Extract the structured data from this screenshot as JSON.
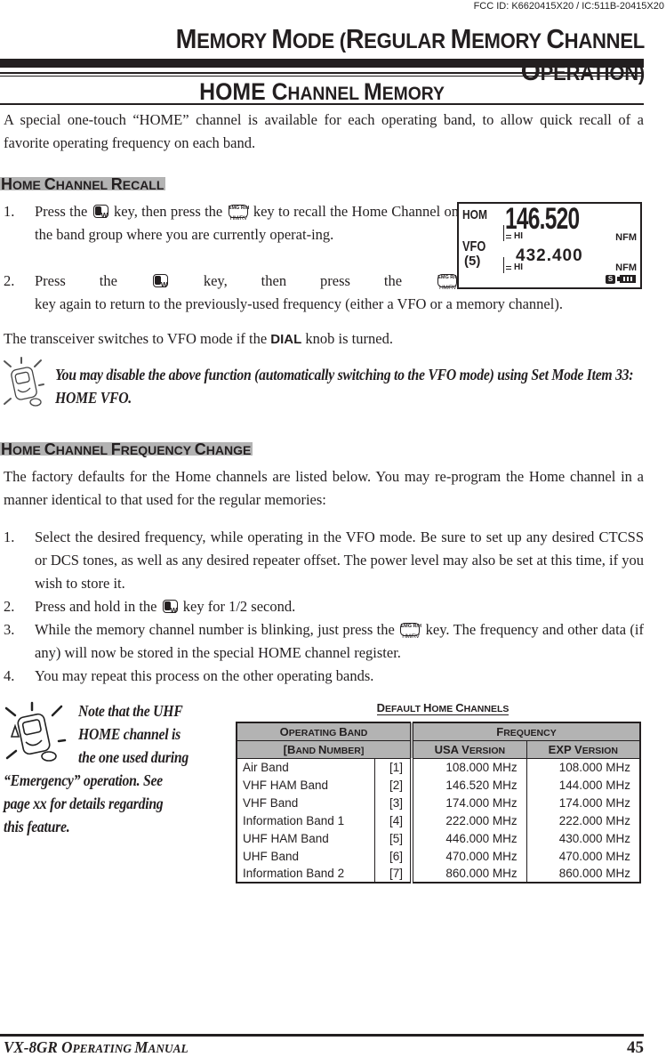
{
  "header": {
    "fcc_id": "FCC ID: K6620415X20 / IC:511B-20415X20",
    "chapter_title_cap1": "M",
    "chapter_title_rest1": "EMORY ",
    "chapter_title_cap2": "M",
    "chapter_title_rest2": "ODE (",
    "chapter_title_cap3": "R",
    "chapter_title_rest3": "EGULAR ",
    "chapter_title_cap4": "M",
    "chapter_title_rest4": "EMORY ",
    "chapter_title_cap5": "C",
    "chapter_title_rest5": "HANNEL ",
    "chapter_title_cap6": "O",
    "chapter_title_rest6": "PERATION)",
    "section_title_a": "HOME ",
    "section_title_cap2": "C",
    "section_title_rest2": "HANNEL ",
    "section_title_cap3": "M",
    "section_title_rest3": "EMORY"
  },
  "intro": "A special one-touch “HOME” channel is available for each operating band, to allow quick recall of a favorite operating frequency on each band.",
  "recall": {
    "heading_cap1": "H",
    "heading_rest1": "OME ",
    "heading_cap2": "C",
    "heading_rest2": "HANNEL ",
    "heading_cap3": "R",
    "heading_rest3": "ECALL",
    "steps": [
      {
        "num": "1.",
        "pre": "Press the",
        "mid": "key, then press the",
        "post": "key to recall the Home Channel on the band group where you are currently operat-ing."
      },
      {
        "num": "2.",
        "pre": "Press the",
        "mid": "key, then press the",
        "post": "key again to return to the previously-used frequency (either a VFO or a memory channel)."
      }
    ],
    "key_fw_label": "W",
    "key_hm_top": "EMG R/H",
    "key_hm_label": "HM/RV",
    "after_pre": "The transceiver switches to VFO mode if the ",
    "after_bold": "DIAL",
    "after_post": " knob is turned.",
    "tip": "You may disable the above function (automatically switching to the VFO mode) using Set Mode Item 33: HOME VFO."
  },
  "lcd": {
    "mode_top": "HOM",
    "freq_top": "146.520",
    "power_top": "HI",
    "mod_top": "NFM",
    "mode_bottom": "VFO",
    "channel_bottom": "(5)",
    "freq_bottom": "432.400",
    "power_bottom": "HI",
    "mod_bottom": "NFM",
    "squelch_icon": "S"
  },
  "change": {
    "heading_cap1": "H",
    "heading_rest1": "OME ",
    "heading_cap2": "C",
    "heading_rest2": "HANNEL ",
    "heading_cap3": "F",
    "heading_rest3": "REQUENCY ",
    "heading_cap4": "C",
    "heading_rest4": "HANGE",
    "intro": "The factory defaults for the Home channels are listed below. You may re-program the Home channel in a manner identical to that used for the regular memories:",
    "step1_num": "1.",
    "step1": "Select the desired frequency, while operating in the VFO mode. Be sure to set up any desired CTCSS or DCS tones, as well as any desired repeater offset. The power level may also be set at this time, if you wish to store it.",
    "step2_num": "2.",
    "step2_pre": "Press and hold in the",
    "step2_post": "key for 1/2 second.",
    "step3_num": "3.",
    "step3_pre": "While the memory channel number is blinking, just press the",
    "step3_post": "key. The frequency and other data (if any) will now be stored in the special HOME channel register.",
    "step4_num": "4.",
    "step4": "You may repeat this process on the other operating bands."
  },
  "note": {
    "line1": "Note that the UHF",
    "line2": "HOME channel is",
    "line3": "the one used during",
    "line4": "“Emergency” operation. See",
    "line5": "page xx for details regarding",
    "line6": "this feature."
  },
  "table": {
    "title_cap1": "D",
    "title_rest1": "EFAULT ",
    "title_cap2": "H",
    "title_rest2": "OME ",
    "title_cap3": "C",
    "title_rest3": "HANNELS",
    "h_band_cap1": "O",
    "h_band_rest1": "PERATING ",
    "h_band_cap2": "B",
    "h_band_rest2": "AND",
    "h_bandnum_a": "[",
    "h_bandnum_cap1": "B",
    "h_bandnum_rest1": "AND ",
    "h_bandnum_cap2": "N",
    "h_bandnum_rest2": "UMBER]",
    "h_freq_cap": "F",
    "h_freq_rest": "REQUENCY",
    "h_usa_a": "USA ",
    "h_usa_cap": "V",
    "h_usa_rest": "ERSION",
    "h_exp_a": "EXP ",
    "h_exp_cap": "V",
    "h_exp_rest": "ERSION",
    "rows": [
      {
        "band": "Air Band",
        "num": "[1]",
        "usa": "108.000 MHz",
        "exp": "108.000 MHz"
      },
      {
        "band": "VHF HAM Band",
        "num": "[2]",
        "usa": "146.520 MHz",
        "exp": "144.000 MHz"
      },
      {
        "band": "VHF Band",
        "num": "[3]",
        "usa": "174.000 MHz",
        "exp": "174.000 MHz"
      },
      {
        "band": "Information Band 1",
        "num": "[4]",
        "usa": "222.000 MHz",
        "exp": "222.000 MHz"
      },
      {
        "band": "UHF HAM Band",
        "num": "[5]",
        "usa": "446.000 MHz",
        "exp": "430.000 MHz"
      },
      {
        "band": "UHF Band",
        "num": "[6]",
        "usa": "470.000 MHz",
        "exp": "470.000 MHz"
      },
      {
        "band": "Information Band 2",
        "num": "[7]",
        "usa": "860.000 MHz",
        "exp": "860.000 MHz"
      }
    ]
  },
  "footer": {
    "manual_a": "VX-8GR ",
    "manual_cap1": "O",
    "manual_rest1": "PERATING ",
    "manual_cap2": "M",
    "manual_rest2": "ANUAL",
    "page_number": "45"
  }
}
